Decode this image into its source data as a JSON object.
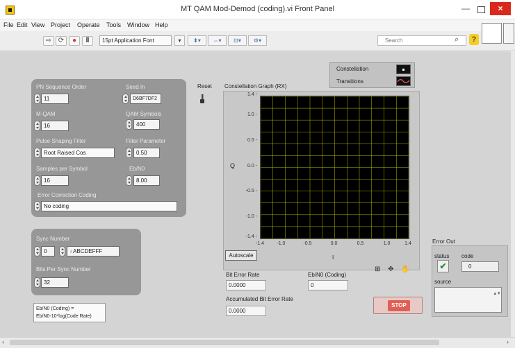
{
  "window": {
    "title": "MT QAM Mod-Demod (coding).vi Front Panel",
    "minimize": "—",
    "close": "×"
  },
  "menu": {
    "items": [
      "File",
      "Edit",
      "View",
      "Project",
      "Operate",
      "Tools",
      "Window",
      "Help"
    ]
  },
  "toolbar": {
    "font": "15pt Application Font",
    "font_arrow": "▾",
    "search_placeholder": "Search",
    "search_icon": "search-icon",
    "help_icon": "help-icon",
    "help_glyph": "?"
  },
  "inputs": {
    "pn_order": {
      "label": "PN Sequence Order",
      "value": "11"
    },
    "seed_in": {
      "label": "Seed In",
      "value": "D6BF7DF2"
    },
    "reset": {
      "label": "Reset"
    },
    "m_qam": {
      "label": "M-QAM",
      "value": "16"
    },
    "qam_symbols": {
      "label": "QAM Symbols",
      "value": "400"
    },
    "pulse_filter": {
      "label": "Pulse Shaping Filter",
      "value": "Root Raised Cos"
    },
    "filter_param": {
      "label": "Filter Parameter",
      "value": "0.50"
    },
    "samples_per_symbol": {
      "label": "Samples per Symbol",
      "value": "16"
    },
    "eb_n0": {
      "label": "Eb/N0",
      "value": "8.00"
    },
    "ecc": {
      "label": "Error Correction Coding",
      "value": "No coding"
    },
    "sync_number": {
      "label": "Sync Number",
      "radix": "0",
      "value": "ABCDEFFF"
    },
    "bits_per_sync": {
      "label": "Bits Per Sync Number",
      "value": "32"
    }
  },
  "graph": {
    "title": "Constellation Graph (RX)",
    "ylabel": "Q",
    "xlabel": "I",
    "legend": [
      "Constellation",
      "Transitions"
    ],
    "yticks": [
      "1.4",
      "1.0",
      "0.5",
      "0.0",
      "-0.5",
      "-1.0",
      "-1.4"
    ],
    "xticks": [
      "-1.4",
      "-1.0",
      "-0.5",
      "0.0",
      "0.5",
      "1.0",
      "1.4"
    ],
    "autoscale": "Autoscale",
    "palette": "⊞ ✥ ✋"
  },
  "chart_data": {
    "type": "scatter",
    "title": "Constellation Graph (RX)",
    "xlabel": "I",
    "ylabel": "Q",
    "xlim": [
      -1.4,
      1.4
    ],
    "ylim": [
      -1.4,
      1.4
    ],
    "grid": true,
    "legend": "top-right",
    "series": [
      {
        "name": "Constellation",
        "points": []
      },
      {
        "name": "Transitions",
        "points": []
      }
    ],
    "colors": {
      "plot_bg": "#000000",
      "grid": "#b8b800"
    }
  },
  "outputs": {
    "ber": {
      "label": "Bit Error Rate",
      "value": "0.0000"
    },
    "eb_n0_coding": {
      "label": "Eb/N0 (Coding)",
      "value": "0"
    },
    "accum_ber": {
      "label": "Accumulated Bit Error Rate",
      "value": "0.0000"
    }
  },
  "error_out": {
    "title": "Error Out",
    "status_label": "status",
    "code_label": "code",
    "code": "0",
    "source_label": "source",
    "status_glyph": "✔",
    "scroll_glyph": "▴ ▾"
  },
  "stop": {
    "label": "STOP"
  },
  "note": {
    "line1": "Eb/N0 (Coding) =",
    "line2": "Eb/N0-10*log(Code Rate)"
  },
  "scroll": {
    "left": "‹",
    "right": "›"
  }
}
